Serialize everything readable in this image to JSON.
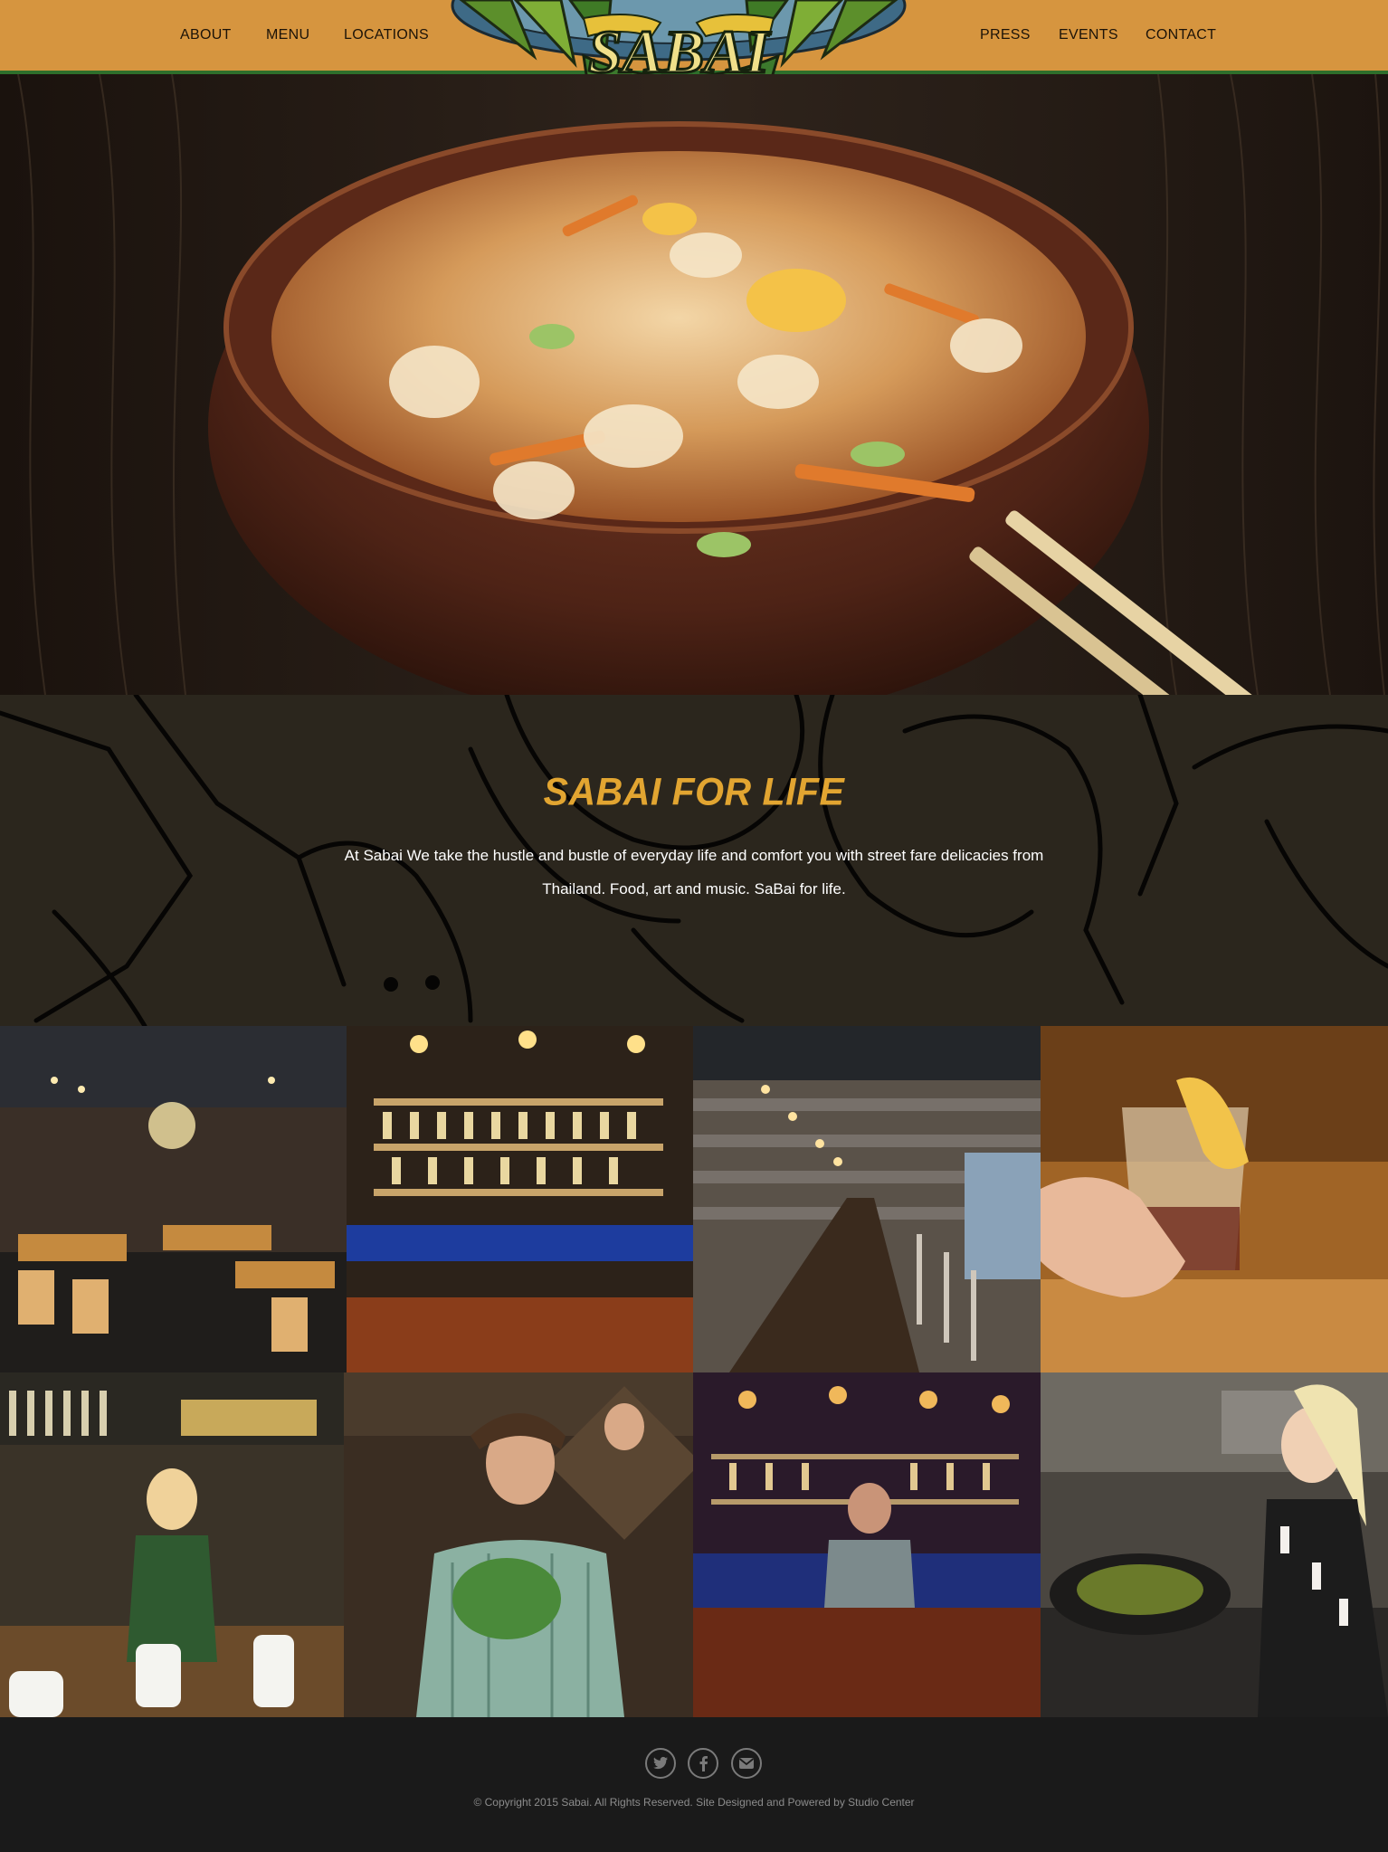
{
  "header": {
    "nav_left": [
      "ABOUT",
      "MENU",
      "LOCATIONS"
    ],
    "nav_right": [
      "PRESS",
      "EVENTS",
      "CONTACT"
    ],
    "logo_text": "SABAI"
  },
  "about": {
    "title": "SABAI FOR LIFE",
    "text": "At Sabai We take the hustle and bustle of everyday life and comfort you with street fare delicacies from Thailand. Food, art and music. SaBai for life."
  },
  "gallery": {
    "photos": [
      "restaurant-dining-room-photo",
      "bar-shelves-photo",
      "long-bar-counter-photo",
      "cocktail-in-hand-photo",
      "bartender-woman-photo",
      "chef-with-herbs-photo",
      "bartender-man-photo",
      "wok-cooking-photo"
    ]
  },
  "footer": {
    "social_icons": [
      "twitter-icon",
      "facebook-icon",
      "email-icon"
    ],
    "copyright": "© Copyright 2015 Sabai. All Rights Reserved. Site Designed and Powered by Studio Center"
  },
  "colors": {
    "header_bg": "#d6953f",
    "header_border": "#2e6f2b",
    "title_gold": "#e2a531",
    "about_bg": "#2b261d",
    "footer_bg": "#1a1a1a"
  }
}
